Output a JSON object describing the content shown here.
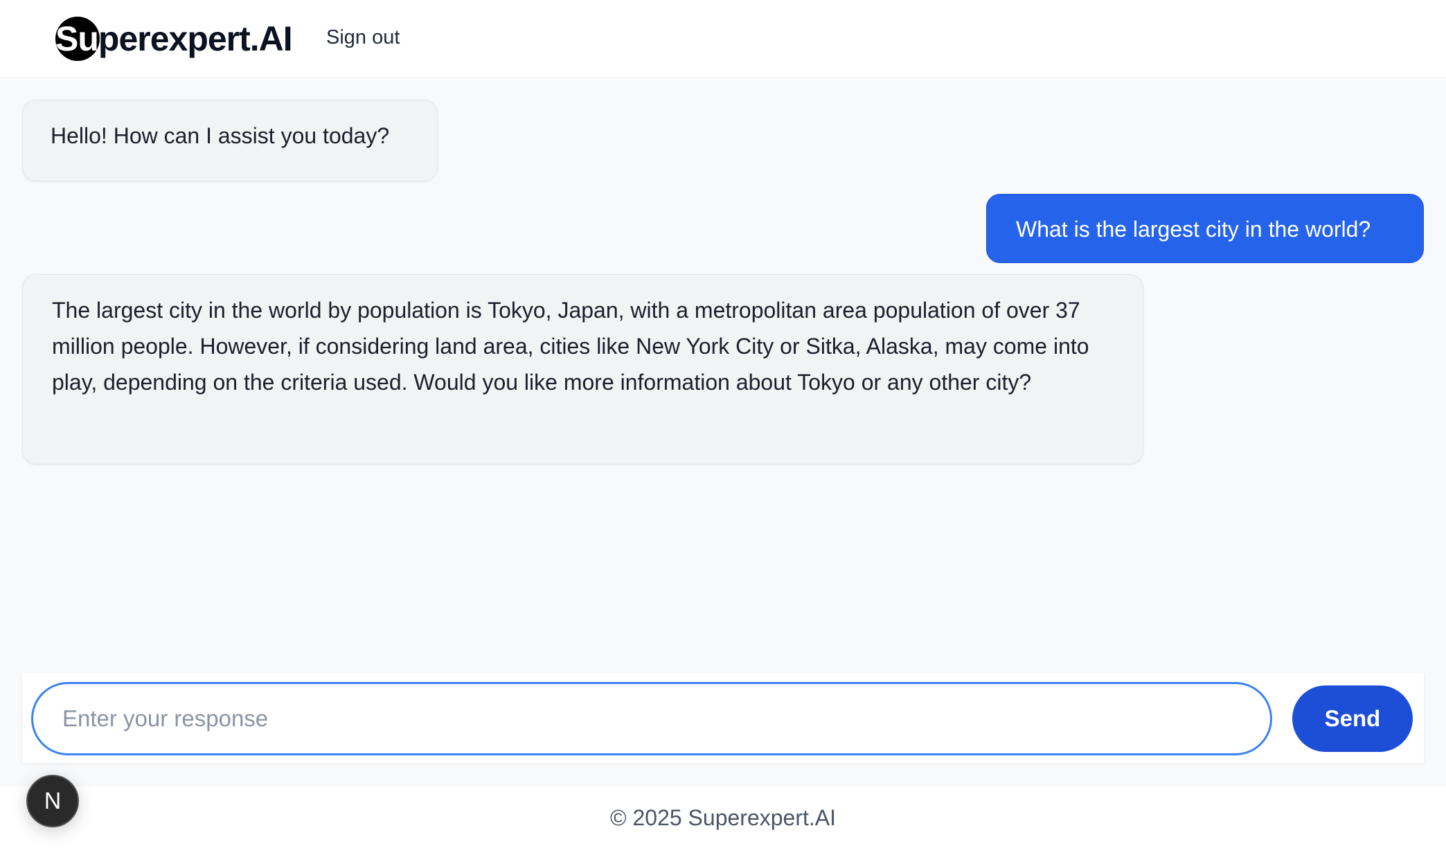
{
  "header": {
    "logo_prefix": "Su",
    "logo_suffix": "perexpert.AI",
    "signout_label": "Sign out"
  },
  "messages": [
    {
      "role": "assistant",
      "text": "Hello! How can I assist you today?"
    },
    {
      "role": "user",
      "text": "What is the largest city in the world?"
    },
    {
      "role": "assistant",
      "text": "The largest city in the world by population is Tokyo, Japan, with a metropolitan area population of over 37 million people. However, if considering land area, cities like New York City or Sitka, Alaska, may come into play, depending on the criteria used. Would you like more information about Tokyo or any other city?"
    }
  ],
  "composer": {
    "placeholder": "Enter your response",
    "value": "",
    "send_label": "Send"
  },
  "footer": {
    "copyright": "© 2025 Superexpert.AI"
  },
  "badge": {
    "letter": "N",
    "icon": "nextjs-icon"
  },
  "colors": {
    "user_bubble": "#2563eb",
    "send_button": "#1d4ed8",
    "input_border": "#3b82f6",
    "ai_bubble": "#f2f3f5"
  }
}
